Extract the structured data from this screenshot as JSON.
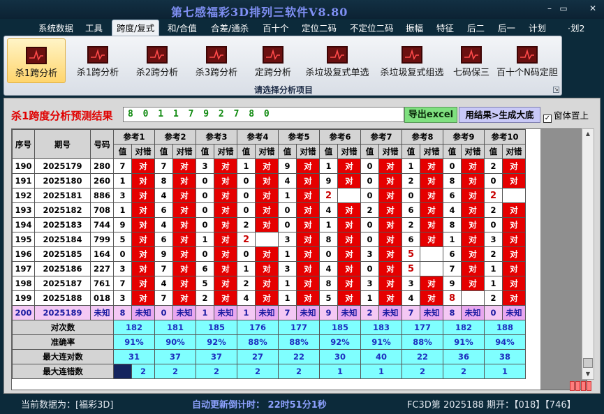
{
  "window": {
    "title": "第七感福彩3D排列三软件V8.80",
    "buttons": [
      "–",
      "▭",
      "✕"
    ]
  },
  "menu": [
    "系统数据",
    "工具",
    "跨度/复式",
    "和/合值",
    "合差/通杀",
    "百十个",
    "定位二码",
    "不定位二码",
    "振幅",
    "特征",
    "后二",
    "后一",
    "计划",
    "·划2"
  ],
  "menu_active": 2,
  "ribbon": {
    "buttons": [
      "杀1跨分析",
      "杀1跨分析",
      "杀2跨分析",
      "杀3跨分析",
      "定跨分析",
      "杀垃圾复式单选",
      "杀垃圾复式组选",
      "七码保三",
      "百十个N码定胆"
    ],
    "active": 0,
    "caption": "请选择分析项目",
    "icon": "chart-icon"
  },
  "result": {
    "title": "杀1跨度分析预测结果",
    "value": "8 0 1 1 7 9 2 7 8 0",
    "export_label": "导出excel",
    "generate_label": "用结果>生成大底",
    "ontop_label": "窗体置上",
    "ontop_checked": true
  },
  "table": {
    "col_seq": "序号",
    "col_issue": "期号",
    "col_number": "号码",
    "groups": [
      "参考1",
      "参考2",
      "参考3",
      "参考4",
      "参考5",
      "参考6",
      "参考7",
      "参考8",
      "参考9",
      "参考10"
    ],
    "sub_value": "值",
    "sub_hit": "对错",
    "hit_text": "对",
    "rows": [
      {
        "seq": "190",
        "issue": "2025179",
        "num": "280",
        "vals": [
          "7",
          "7",
          "3",
          "1",
          "9",
          "1",
          "0",
          "1",
          "0",
          "2"
        ],
        "miss": []
      },
      {
        "seq": "191",
        "issue": "2025180",
        "num": "260",
        "vals": [
          "1",
          "8",
          "0",
          "0",
          "4",
          "9",
          "0",
          "2",
          "8",
          "0"
        ],
        "miss": []
      },
      {
        "seq": "192",
        "issue": "2025181",
        "num": "886",
        "vals": [
          "3",
          "4",
          "0",
          "0",
          "1",
          "2",
          "0",
          "0",
          "6",
          "2"
        ],
        "miss": [
          5,
          9
        ]
      },
      {
        "seq": "193",
        "issue": "2025182",
        "num": "708",
        "vals": [
          "1",
          "6",
          "0",
          "0",
          "0",
          "4",
          "2",
          "6",
          "4",
          "2"
        ],
        "miss": []
      },
      {
        "seq": "194",
        "issue": "2025183",
        "num": "744",
        "vals": [
          "9",
          "4",
          "0",
          "2",
          "0",
          "1",
          "0",
          "2",
          "8",
          "0"
        ],
        "miss": []
      },
      {
        "seq": "195",
        "issue": "2025184",
        "num": "799",
        "vals": [
          "5",
          "6",
          "1",
          "2",
          "3",
          "8",
          "0",
          "6",
          "1",
          "3"
        ],
        "miss": [
          3
        ]
      },
      {
        "seq": "196",
        "issue": "2025185",
        "num": "164",
        "vals": [
          "0",
          "9",
          "0",
          "0",
          "1",
          "0",
          "3",
          "5",
          "6",
          "2"
        ],
        "miss": [
          7
        ]
      },
      {
        "seq": "197",
        "issue": "2025186",
        "num": "227",
        "vals": [
          "3",
          "7",
          "6",
          "1",
          "3",
          "4",
          "0",
          "5",
          "7",
          "1"
        ],
        "miss": [
          7
        ]
      },
      {
        "seq": "198",
        "issue": "2025187",
        "num": "761",
        "vals": [
          "7",
          "4",
          "5",
          "2",
          "1",
          "8",
          "3",
          "3",
          "9",
          "1"
        ],
        "miss": []
      },
      {
        "seq": "199",
        "issue": "2025188",
        "num": "018",
        "vals": [
          "3",
          "7",
          "2",
          "4",
          "1",
          "5",
          "1",
          "4",
          "8",
          "2"
        ],
        "miss": [
          8
        ]
      }
    ],
    "pending": {
      "seq": "200",
      "issue": "2025189",
      "num": "未知",
      "vals": [
        "8",
        "0",
        "1",
        "1",
        "7",
        "9",
        "2",
        "7",
        "8",
        "0"
      ],
      "hit_text": "未知"
    },
    "stats": [
      {
        "label": "对次数",
        "values": [
          "182",
          "181",
          "185",
          "176",
          "177",
          "185",
          "183",
          "177",
          "182",
          "188"
        ]
      },
      {
        "label": "准确率",
        "values": [
          "91%",
          "90%",
          "92%",
          "88%",
          "88%",
          "92%",
          "91%",
          "88%",
          "91%",
          "94%"
        ]
      },
      {
        "label": "最大连对数",
        "values": [
          "31",
          "37",
          "37",
          "27",
          "22",
          "30",
          "40",
          "22",
          "36",
          "38"
        ]
      },
      {
        "label": "最大连错数",
        "values": [
          "2",
          "2",
          "2",
          "2",
          "2",
          "1",
          "1",
          "2",
          "2",
          "1"
        ]
      }
    ]
  },
  "status": {
    "current_label": "当前数据为：[福彩3D]",
    "countdown": "自动更新倒计时： 22时51分1秒",
    "draw": "FC3D第 2025188 期开：【018】【746】"
  },
  "colors": {
    "hit": "#e50000",
    "pending": "#f4c8f4",
    "stats": "#7fffff",
    "title_red": "#e00000",
    "menu_title": "#7f8ff3"
  }
}
